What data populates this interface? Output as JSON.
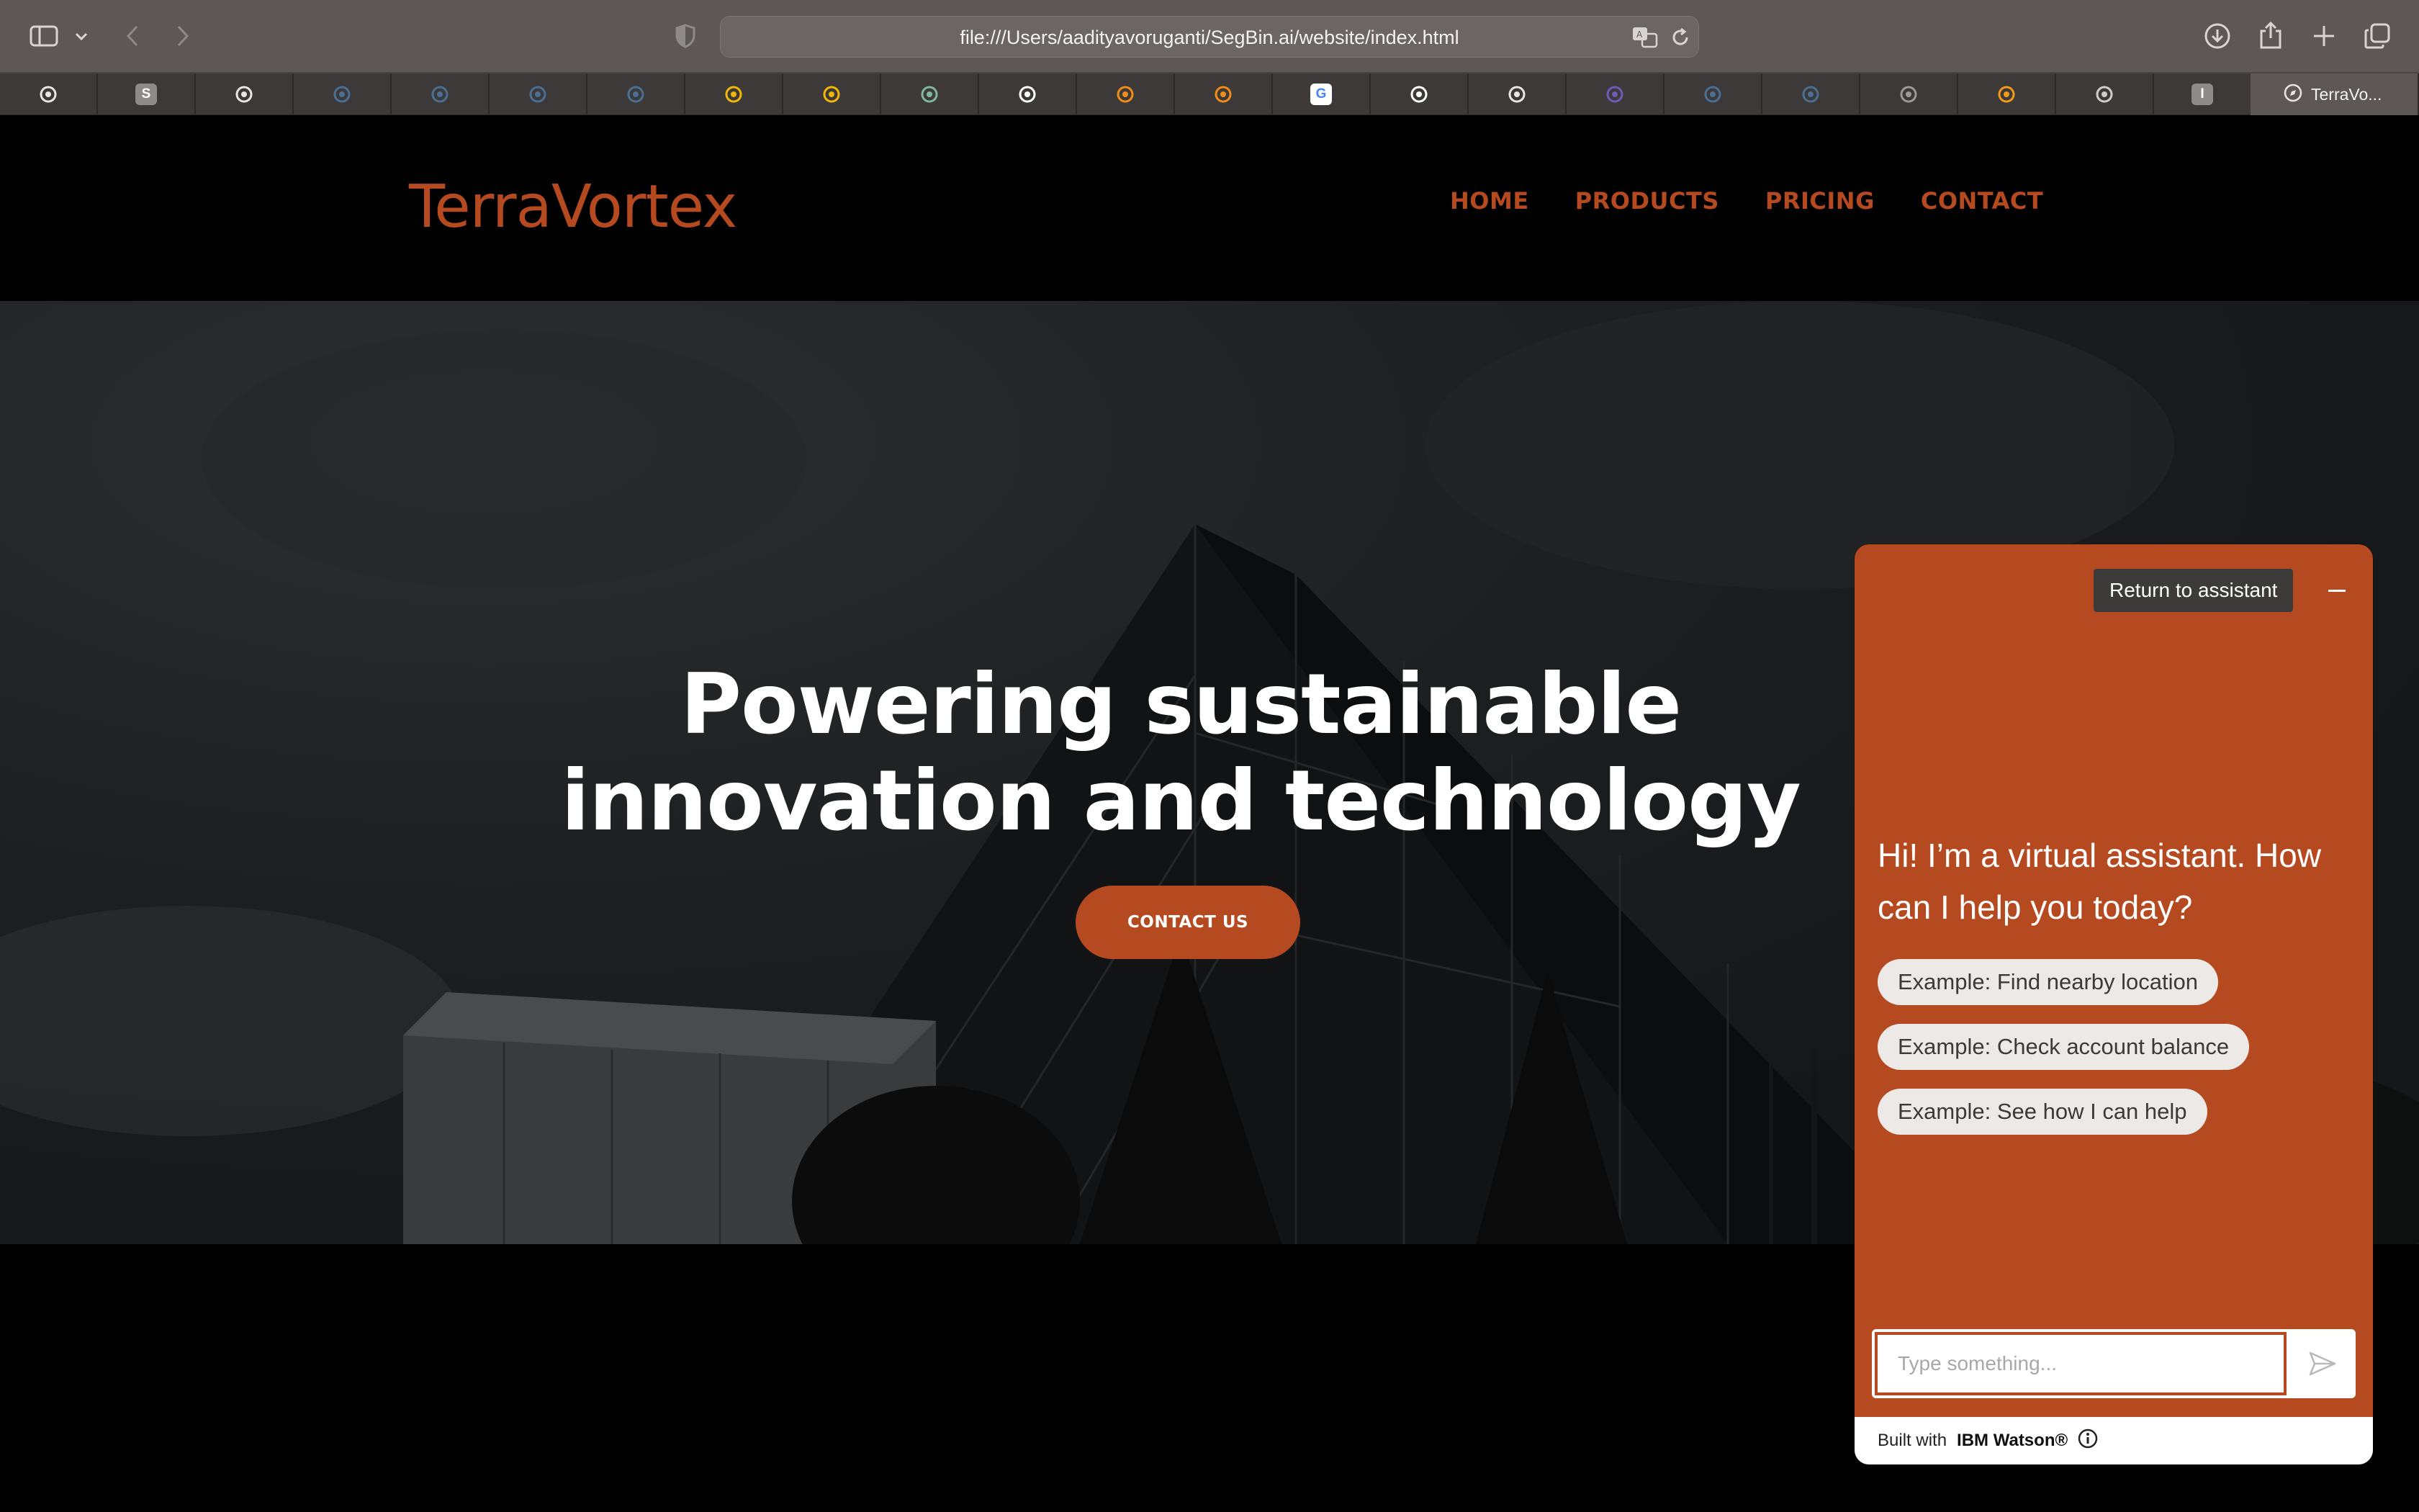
{
  "browser": {
    "url": "file:///Users/aadityavoruganti/SegBin.ai/website/index.html",
    "active_tab_title": "TerraVo...",
    "tabs": [
      {
        "icon": "bee-icon",
        "letter": "",
        "color": "#e8e6e4"
      },
      {
        "icon": "letter-s-icon",
        "letter": "S",
        "color": "#8e8a88"
      },
      {
        "icon": "bee-icon",
        "letter": "",
        "color": "#e8e6e4"
      },
      {
        "icon": "cloud-icon",
        "letter": "",
        "color": "#4a6f95"
      },
      {
        "icon": "cloud-icon",
        "letter": "",
        "color": "#4a6f95"
      },
      {
        "icon": "cloud-icon",
        "letter": "",
        "color": "#4a6f95"
      },
      {
        "icon": "cloud-icon",
        "letter": "",
        "color": "#4a6f95"
      },
      {
        "icon": "google-drive-icon",
        "letter": "",
        "color": "#f2b705"
      },
      {
        "icon": "google-drive-icon",
        "letter": "",
        "color": "#f2b705"
      },
      {
        "icon": "openai-icon",
        "letter": "",
        "color": "#7fb7a4"
      },
      {
        "icon": "github-icon",
        "letter": "",
        "color": "#ffffff"
      },
      {
        "icon": "tensorflow-icon",
        "letter": "",
        "color": "#f28c18"
      },
      {
        "icon": "tensorflow-icon",
        "letter": "",
        "color": "#f28c18"
      },
      {
        "icon": "google-icon",
        "letter": "G",
        "color": "#ffffff"
      },
      {
        "icon": "github-icon",
        "letter": "",
        "color": "#ffffff"
      },
      {
        "icon": "bee-icon",
        "letter": "",
        "color": "#e8e6e4"
      },
      {
        "icon": "circle-logo-icon",
        "letter": "",
        "color": "#6f5ab8"
      },
      {
        "icon": "cloud-icon",
        "letter": "",
        "color": "#4a6f95"
      },
      {
        "icon": "cloud-icon",
        "letter": "",
        "color": "#4a6f95"
      },
      {
        "icon": "bee-icon",
        "letter": "",
        "color": "#9d9997"
      },
      {
        "icon": "infinity-icon",
        "letter": "",
        "color": "#f29a18"
      },
      {
        "icon": "compass-icon",
        "letter": "",
        "color": "#d0ccca"
      },
      {
        "icon": "letter-i-icon",
        "letter": "I",
        "color": "#8e8a88"
      }
    ]
  },
  "site": {
    "logo": "TerraVortex",
    "nav": [
      "HOME",
      "PRODUCTS",
      "PRICING",
      "CONTACT"
    ],
    "hero": {
      "title_line1": "Powering sustainable",
      "title_line2": "innovation and technology",
      "cta": "CONTACT US"
    },
    "accent_color": "#b5491f"
  },
  "chat": {
    "restart_label": "Return to assistant",
    "greeting": "Hi! I’m a virtual assistant. How can I help you today?",
    "suggestions": [
      "Example: Find nearby location",
      "Example: Check account balance",
      "Example: See how I can help"
    ],
    "input_placeholder": "Type something...",
    "footer_prefix": "Built with",
    "footer_brand": "IBM Watson®"
  }
}
